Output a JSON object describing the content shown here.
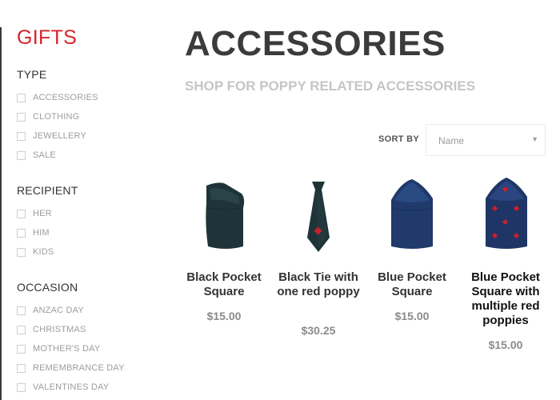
{
  "sidebar": {
    "title": "GIFTS",
    "sections": [
      {
        "heading": "TYPE",
        "items": [
          "ACCESSORIES",
          "CLOTHING",
          "JEWELLERY",
          "SALE"
        ]
      },
      {
        "heading": "RECIPIENT",
        "items": [
          "HER",
          "HIM",
          "KIDS"
        ]
      },
      {
        "heading": "OCCASION",
        "items": [
          "ANZAC DAY",
          "CHRISTMAS",
          "MOTHER'S DAY",
          "REMEMBRANCE DAY",
          "VALENTINES DAY"
        ]
      }
    ]
  },
  "main": {
    "title": "ACCESSORIES",
    "subtitle": "SHOP FOR POPPY RELATED ACCESSORIES",
    "sort": {
      "label": "SORT BY",
      "value": "Name"
    },
    "products": [
      {
        "name": "Black Pocket Square",
        "price": "$15.00",
        "icon": "black-pocket-square-image",
        "color": "#1f3438"
      },
      {
        "name": "Black Tie with one red poppy",
        "price": "$30.25",
        "icon": "black-tie-image",
        "color": "#1f3438"
      },
      {
        "name": "Blue Pocket Square",
        "price": "$15.00",
        "icon": "blue-pocket-square-image",
        "color": "#1f3a6b"
      },
      {
        "name": "Blue Pocket Square with multiple red poppies",
        "price": "$15.00",
        "icon": "blue-poppy-pocket-square-image",
        "color": "#1f3566"
      }
    ]
  },
  "colors": {
    "accent": "#d8232a",
    "poppy": "#c9202a"
  }
}
